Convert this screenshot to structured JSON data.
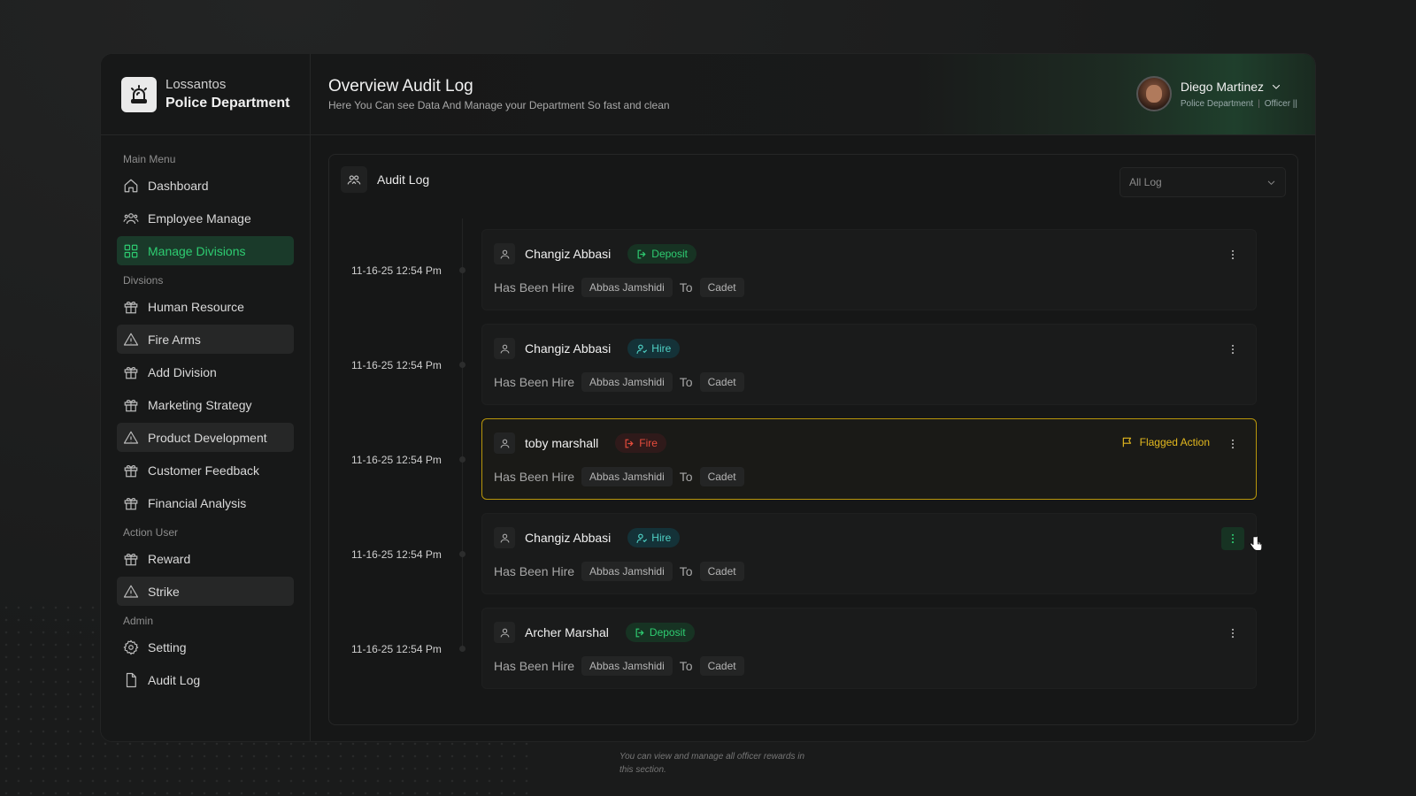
{
  "brand": {
    "line1": "Lossantos",
    "line2": "Police Department",
    "icon": "siren-icon"
  },
  "sidebar": {
    "main_menu_label": "Main Menu",
    "main_items": [
      {
        "label": "Dashboard",
        "icon": "home-icon"
      },
      {
        "label": "Employee Manage",
        "icon": "users-icon"
      },
      {
        "label": "Manage Divisions",
        "icon": "grid-icon",
        "active": true
      }
    ],
    "divisions_label": "Divsions",
    "division_items": [
      {
        "label": "Human Resource",
        "icon": "gift-icon"
      },
      {
        "label": "Fire Arms",
        "icon": "warning-icon"
      },
      {
        "label": "Add Division",
        "icon": "gift-icon"
      },
      {
        "label": "Marketing Strategy",
        "icon": "gift-icon"
      },
      {
        "label": "Product Development",
        "icon": "warning-icon"
      },
      {
        "label": "Customer Feedback",
        "icon": "gift-icon"
      },
      {
        "label": "Financial Analysis",
        "icon": "gift-icon"
      }
    ],
    "action_user_label": "Action User",
    "action_items": [
      {
        "label": "Reward",
        "icon": "gift-icon"
      },
      {
        "label": "Strike",
        "icon": "warning-icon"
      }
    ],
    "admin_label": "Admin",
    "admin_items": [
      {
        "label": "Setting",
        "icon": "gear-icon"
      },
      {
        "label": "Audit Log",
        "icon": "document-icon"
      }
    ]
  },
  "header": {
    "title": "Overview Audit Log",
    "subtitle": "Here You Can see Data And Manage your Department So fast and clean"
  },
  "user": {
    "name": "Diego Martinez",
    "department": "Police Department",
    "separator": "|",
    "rank": "Officer ||"
  },
  "panel": {
    "title": "Audit Log",
    "filter_value": "All Log"
  },
  "entries": [
    {
      "time": "11-16-25 12:54 Pm",
      "name": "Changiz Abbasi",
      "badge": "Deposit",
      "badge_type": "deposit",
      "action": "Has Been Hire",
      "target": "Abbas Jamshidi",
      "to": "To",
      "role": "Cadet"
    },
    {
      "time": "11-16-25 12:54 Pm",
      "name": "Changiz Abbasi",
      "badge": "Hire",
      "badge_type": "hire",
      "action": "Has Been Hire",
      "target": "Abbas Jamshidi",
      "to": "To",
      "role": "Cadet"
    },
    {
      "time": "11-16-25 12:54 Pm",
      "name": "toby marshall",
      "badge": "Fire",
      "badge_type": "fire",
      "flag": "Flagged Action",
      "action": "Has Been Hire",
      "target": "Abbas Jamshidi",
      "to": "To",
      "role": "Cadet"
    },
    {
      "time": "11-16-25 12:54 Pm",
      "name": "Changiz Abbasi",
      "badge": "Hire",
      "badge_type": "hire",
      "action": "Has Been Hire",
      "target": "Abbas Jamshidi",
      "to": "To",
      "role": "Cadet"
    },
    {
      "time": "11-16-25 12:54 Pm",
      "name": "Archer Marshal",
      "badge": "Deposit",
      "badge_type": "deposit",
      "action": "Has Been Hire",
      "target": "Abbas Jamshidi",
      "to": "To",
      "role": "Cadet"
    }
  ],
  "footer_note": "You can view and manage all officer rewards in this section.",
  "colors": {
    "accent": "#2ecc71",
    "flag": "#e3b81e",
    "danger": "#e74c3c",
    "hire": "#4fd1c5"
  }
}
